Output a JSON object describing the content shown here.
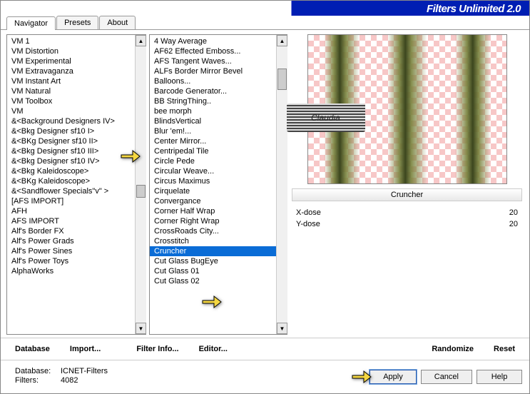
{
  "header": {
    "title": "Filters Unlimited 2.0"
  },
  "tabs": {
    "items": [
      "Navigator",
      "Presets",
      "About"
    ],
    "active": 0
  },
  "categories": {
    "items": [
      "VM 1",
      "VM Distortion",
      "VM Experimental",
      "VM Extravaganza",
      "VM Instant Art",
      "VM Natural",
      "VM Toolbox",
      "VM",
      "&<Background Designers IV>",
      "&<Bkg Designer sf10 I>",
      "&<BKg Designer sf10 II>",
      "&<Bkg Designer sf10 III>",
      "&<Bkg Designer sf10 IV>",
      "&<Bkg Kaleidoscope>",
      "&<BKg Kaleidoscope>",
      "&<Sandflower Specials\"v\" >",
      "[AFS IMPORT]",
      "AFH",
      "AFS IMPORT",
      "Alf's Border FX",
      "Alf's Power Grads",
      "Alf's Power Sines",
      "Alf's Power Toys",
      "AlphaWorks"
    ],
    "highlighted_index": 9
  },
  "filters": {
    "items": [
      "4 Way Average",
      "AF62 Effected Emboss...",
      "AFS Tangent Waves...",
      "ALFs Border Mirror Bevel",
      "Balloons...",
      "Barcode Generator...",
      "BB StringThing..",
      "bee morph",
      "BlindsVertical",
      "Blur 'em!...",
      "Center Mirror...",
      "Centripedal Tile",
      "Circle Pede",
      "Circular Weave...",
      "Circus Maximus",
      "Cirquelate",
      "Convergance",
      "Corner Half Wrap",
      "Corner Right Wrap",
      "CrossRoads City...",
      "Crosstitch",
      "Cruncher",
      "Cut Glass  BugEye",
      "Cut Glass 01",
      "Cut Glass 02"
    ],
    "selected_index": 21
  },
  "preview": {
    "filter_name": "Cruncher",
    "watermark": "Claudia",
    "params": [
      {
        "label": "X-dose",
        "value": "20"
      },
      {
        "label": "Y-dose",
        "value": "20"
      }
    ]
  },
  "buttons": {
    "database": "Database",
    "import": "Import...",
    "filter_info": "Filter Info...",
    "editor": "Editor...",
    "randomize": "Randomize",
    "reset": "Reset",
    "apply": "Apply",
    "cancel": "Cancel",
    "help": "Help"
  },
  "status": {
    "db_label": "Database:",
    "db_value": "ICNET-Filters",
    "count_label": "Filters:",
    "count_value": "4082"
  }
}
